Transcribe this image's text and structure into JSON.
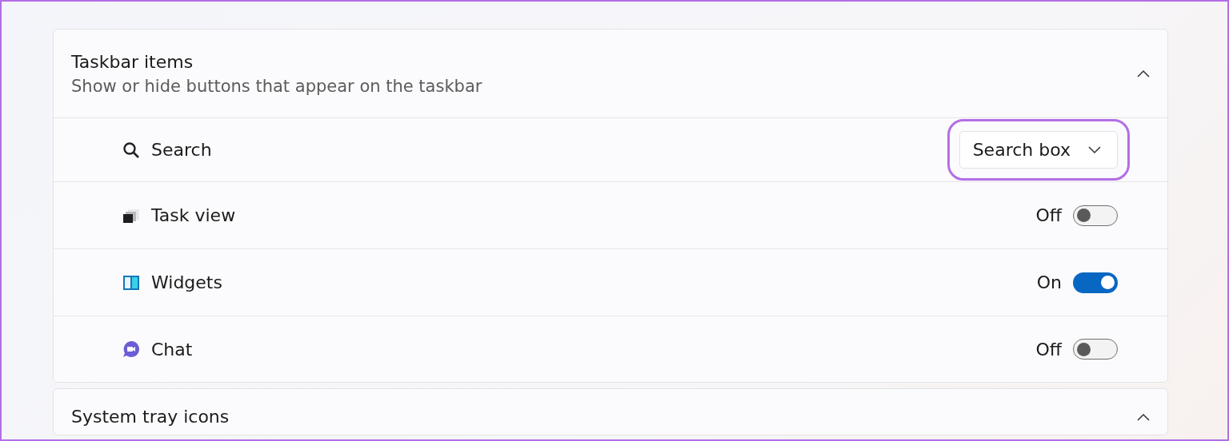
{
  "sections": [
    {
      "title": "Taskbar items",
      "subtitle": "Show or hide buttons that appear on the taskbar",
      "expanded": true,
      "items": [
        {
          "kind": "dropdown",
          "label": "Search",
          "value": "Search box",
          "highlighted": true
        },
        {
          "kind": "toggle",
          "label": "Task view",
          "state": "Off",
          "on": false
        },
        {
          "kind": "toggle",
          "label": "Widgets",
          "state": "On",
          "on": true
        },
        {
          "kind": "toggle",
          "label": "Chat",
          "state": "Off",
          "on": false
        }
      ]
    },
    {
      "title": "System tray icons",
      "expanded": true
    }
  ]
}
